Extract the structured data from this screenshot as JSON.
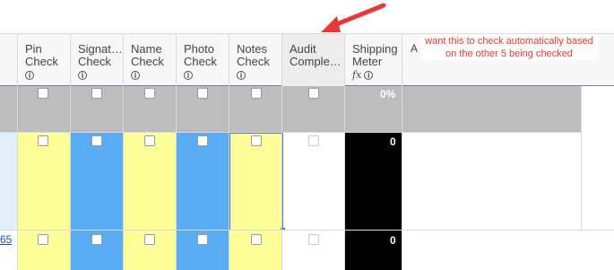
{
  "columns": [
    {
      "label": "Pin\nCheck",
      "info": "i"
    },
    {
      "label": "Signat…\nCheck",
      "info": "i"
    },
    {
      "label": "Name\nCheck",
      "info": "i"
    },
    {
      "label": "Photo\nCheck",
      "info": "i"
    },
    {
      "label": "Notes\nCheck",
      "info": "i"
    },
    {
      "label": "Audit\nComple…",
      "info": ""
    },
    {
      "label": "Shipping\nMeter",
      "info": "i",
      "formula": "fx"
    },
    {
      "label": "A",
      "info": ""
    }
  ],
  "summary_row": {
    "shipping_meter": "0%"
  },
  "rows": [
    {
      "shipping_meter": "0"
    },
    {
      "shipping_meter": "0"
    }
  ],
  "link_fragment": "65",
  "annotation": {
    "text": "want this to check automatically based on the other 5 being checked"
  },
  "colors": {
    "yellow": "#ffff99",
    "blue": "#5aadf5",
    "summary_grey": "#bdbdbd",
    "annotation_red": "#e53935",
    "selection_border": "#4a7cc2"
  }
}
